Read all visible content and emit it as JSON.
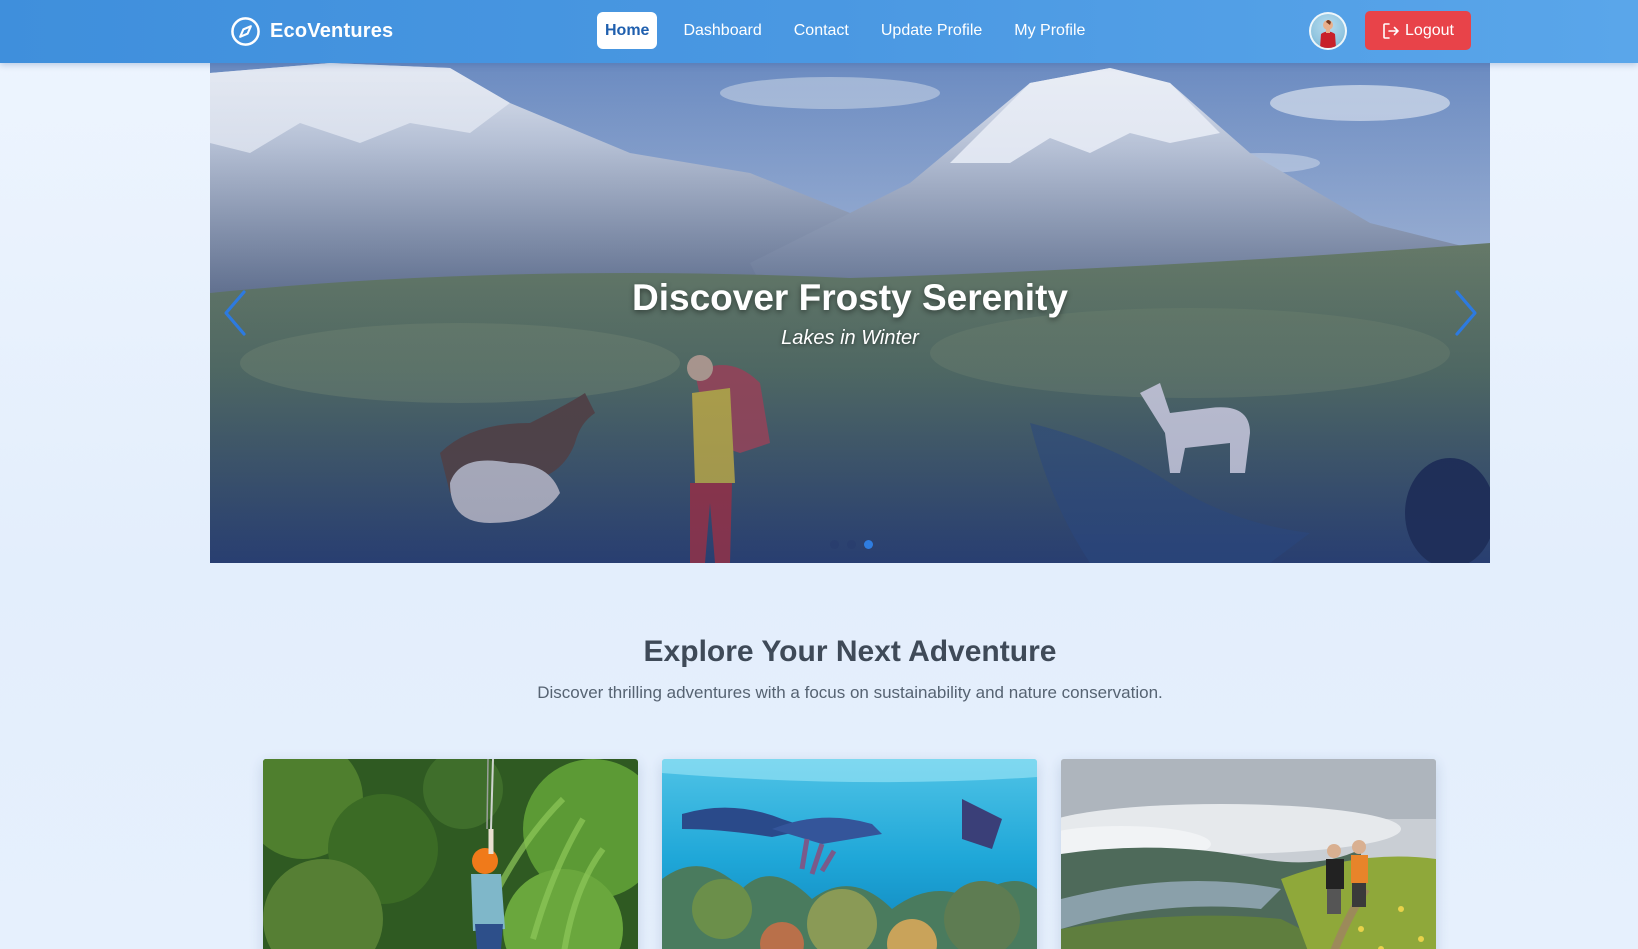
{
  "navbar": {
    "brand": "EcoVentures",
    "links": [
      {
        "label": "Home",
        "active": true
      },
      {
        "label": "Dashboard",
        "active": false
      },
      {
        "label": "Contact",
        "active": false
      },
      {
        "label": "Update Profile",
        "active": false
      },
      {
        "label": "My Profile",
        "active": false
      }
    ],
    "logout_label": "Logout"
  },
  "hero": {
    "title": "Discover Frosty Serenity",
    "subtitle": "Lakes in Winter",
    "slide_count": 3,
    "active_slide": 3
  },
  "section": {
    "title": "Explore Your Next Adventure",
    "subtitle": "Discover thrilling adventures with a focus on sustainability and nature conservation."
  },
  "cards": [
    {
      "image": "zipline-rainforest"
    },
    {
      "image": "coral-reef-snorkeling"
    },
    {
      "image": "mountain-hiking"
    }
  ],
  "colors": {
    "nav_gradient_start": "#3f8fdc",
    "nav_gradient_end": "#5aa6ea",
    "logout": "#e84349",
    "indicator_active": "#2f7de0"
  }
}
